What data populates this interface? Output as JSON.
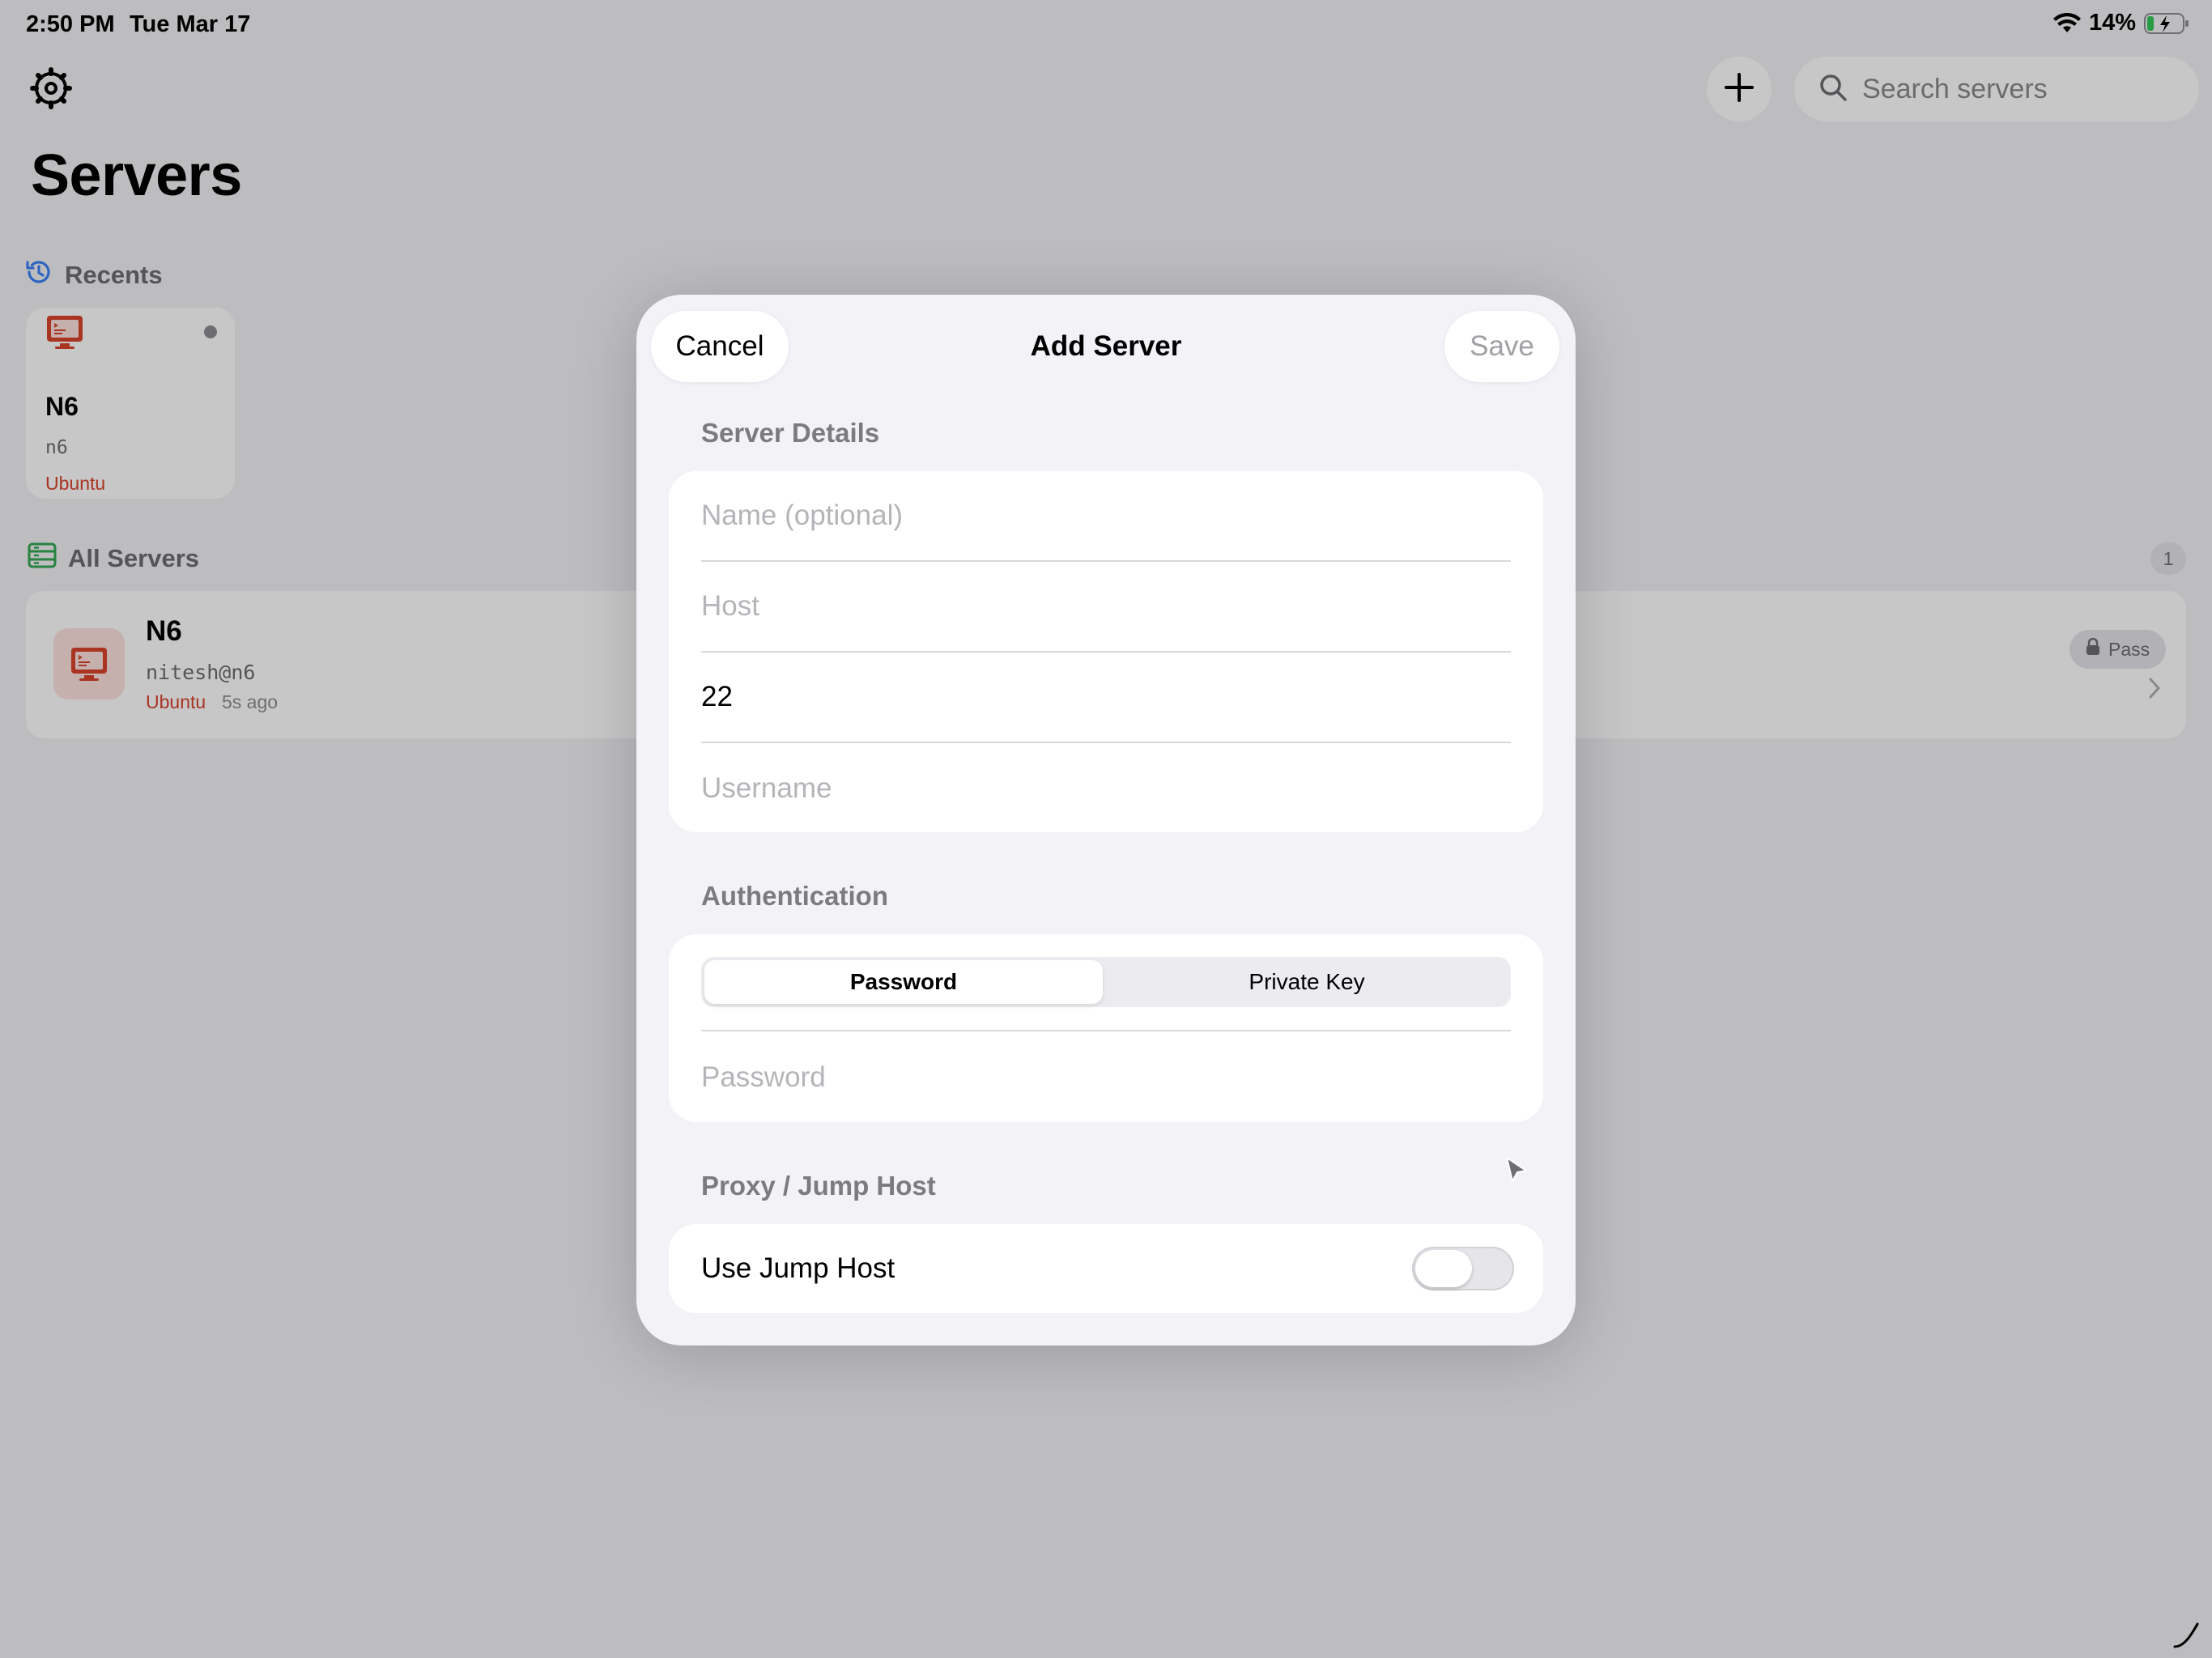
{
  "status_bar": {
    "time": "2:50 PM",
    "date": "Tue Mar 17",
    "battery_percent": "14%",
    "charging": true
  },
  "toolbar": {
    "settings_icon": "gear-icon",
    "add_icon": "plus-icon",
    "search_placeholder": "Search servers"
  },
  "page_title": "Servers",
  "recents": {
    "label": "Recents",
    "items": [
      {
        "name": "N6",
        "host": "n6",
        "os": "Ubuntu"
      }
    ]
  },
  "all_servers": {
    "label": "All Servers",
    "count": "1",
    "rows": [
      {
        "name": "N6",
        "user_host": "nitesh@n6",
        "os": "Ubuntu",
        "last_used": "5s ago",
        "auth": "Pass"
      }
    ]
  },
  "modal": {
    "title": "Add Server",
    "cancel_label": "Cancel",
    "save_label": "Save",
    "server_details": {
      "label": "Server Details",
      "name_placeholder": "Name (optional)",
      "host_placeholder": "Host",
      "port_value": "22",
      "username_placeholder": "Username"
    },
    "authentication": {
      "label": "Authentication",
      "options": [
        "Password",
        "Private Key"
      ],
      "selected": "Password",
      "password_placeholder": "Password"
    },
    "proxy": {
      "label": "Proxy / Jump Host",
      "toggle_label": "Use Jump Host",
      "enabled": false
    }
  },
  "colors": {
    "accent_red": "#d9432b",
    "recents_icon_blue": "#3b82f6",
    "all_servers_icon_green": "#34a853"
  }
}
